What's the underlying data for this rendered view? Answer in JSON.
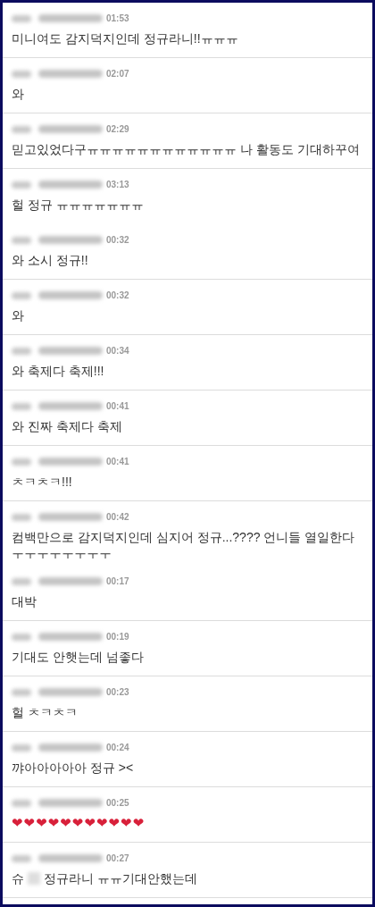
{
  "messages": [
    {
      "time": "01:53",
      "text": "미니여도 감지덕지인데 정규라니!!ㅠㅠㅠ",
      "divider": true
    },
    {
      "time": "02:07",
      "text": "와",
      "divider": true
    },
    {
      "time": "02:29",
      "text": "믿고있었다구ㅠㅠㅠㅠㅠㅠㅠㅠㅠㅠㅠㅠ 나 활동도 기대하꾸여",
      "divider": true
    },
    {
      "time": "03:13",
      "text": "헐 정규 ㅠㅠㅠㅠㅠㅠㅠ",
      "divider": false
    },
    {
      "time": "00:32",
      "text": "와 소시 정규!!",
      "divider": true
    },
    {
      "time": "00:32",
      "text": "와",
      "divider": true
    },
    {
      "time": "00:34",
      "text": "와 축제다 축제!!!",
      "divider": true
    },
    {
      "time": "00:41",
      "text": "와 진짜 축제다 축제",
      "divider": true
    },
    {
      "time": "00:41",
      "text": "ㅊㅋㅊㅋ!!!",
      "divider": true
    },
    {
      "time": "00:42",
      "text": "컴백만으로 감지덕지인데 심지어 정규...???? 언니들 열일한다ㅜㅜㅜㅜㅜㅜㅜㅜ",
      "divider": false
    },
    {
      "time": "00:17",
      "text": "대박",
      "divider": true
    },
    {
      "time": "00:19",
      "text": "기대도 안햇는데 넘좋다",
      "divider": true
    },
    {
      "time": "00:23",
      "text": "헐 ㅊㅋㅊㅋ",
      "divider": true
    },
    {
      "time": "00:24",
      "text": "꺄아아아아아 정규 ><",
      "divider": true
    },
    {
      "time": "00:25",
      "text": "❤❤❤❤❤❤❤❤❤❤❤",
      "kind": "hearts",
      "divider": true
    },
    {
      "time": "00:27",
      "text": "슈",
      "text_after": "정규라니 ㅠㅠ기대안했는데",
      "kind": "redacted",
      "divider": true
    }
  ]
}
